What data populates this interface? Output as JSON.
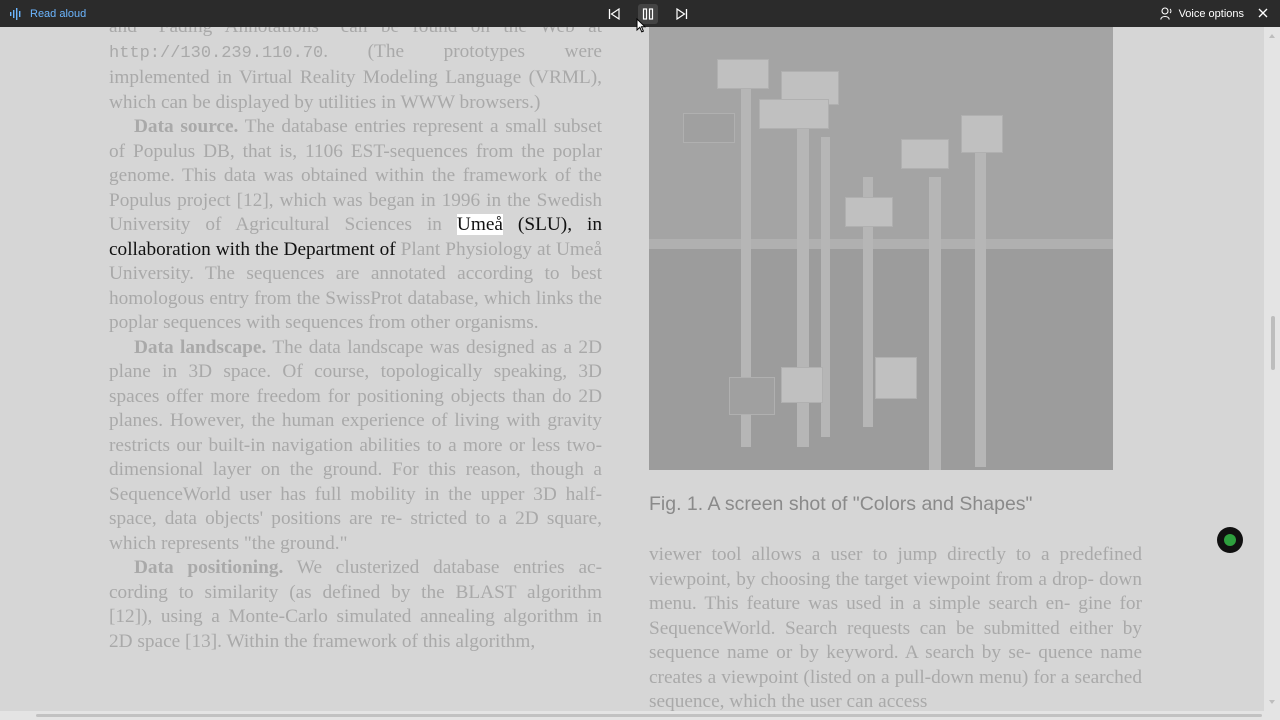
{
  "toolbar": {
    "read_aloud": "Read aloud",
    "voice_options": "Voice options",
    "accent": "#6cb6ff"
  },
  "content": {
    "left": {
      "p1": "and “Fading Annotations” can be found on the Web at",
      "p1_url": "http://130.239.110.70",
      "p1_rest": ". (The prototypes were implemented in Virtual Reality Modeling Language (VRML), which can be displayed by utilities in WWW browsers.)",
      "p2_head": "Data source.",
      "p2_a": " The database entries represent a small subset of Populus DB, that is, 1106 EST-sequences from the poplar genome. This data was obtained within the framework of the Populus project [12], which was began in 1996 in the Swedish University of Agricultural Sciences in ",
      "p2_word": "Umeå",
      "p2_hl": " (SLU), in collaboration with the Department of",
      "p2_b": " Plant Physiology at Umeå University. The sequences are annotated according to best homologous entry from the SwissProt database, which links the poplar sequences with sequences from other organisms.",
      "p3_head": "Data landscape.",
      "p3": " The data landscape was designed as a 2D plane in 3D space. Of course, topologically speaking, 3D spaces offer more freedom for positioning objects than do 2D planes. However, the human experience of living with gravity restricts our built-in navigation abilities to a more or less two-dimensional layer on the ground. For this reason, though a SequenceWorld user has full mobility in the upper 3D half-space, data objects' positions are re- stricted to a 2D square, which represents \"the ground.\"",
      "p4_head": "Data positioning.",
      "p4": " We clusterized database entries ac- cording to similarity (as defined by the BLAST algorithm [12]), using a Monte-Carlo simulated annealing algorithm in 2D space [13]. Within the framework of this algorithm,"
    },
    "figure_caption": "Fig. 1. A screen shot of \"Colors and Shapes\"",
    "right": {
      "p1": "viewer tool allows a user to jump directly to a predefined viewpoint, by choosing the target viewpoint from a drop- down menu. This feature was used in a simple search en- gine for SequenceWorld. Search requests can be submitted either by sequence name or by keyword. A search by se- quence name creates a viewpoint (listed on a pull-down menu) for a searched sequence, which the user can access"
    }
  }
}
